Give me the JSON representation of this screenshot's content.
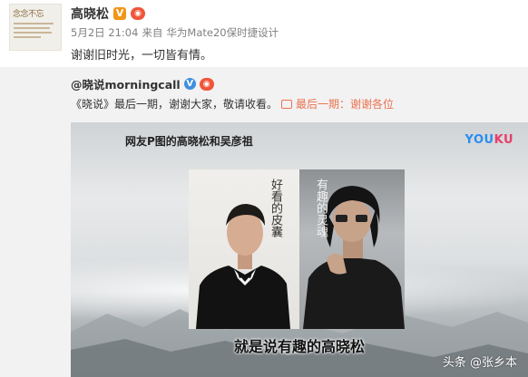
{
  "post": {
    "author_name": "高晓松",
    "verified_badge": "V",
    "date": "5月2日 21:04",
    "source_prefix": "来自",
    "source": "华为Mate20保时捷设计",
    "text": "谢谢旧时光，一切皆有情。"
  },
  "repost": {
    "author": "@晓说morningcall",
    "text_prefix": "《晓说》最后一期，谢谢大家，敬请收看。",
    "link_text": "最后一期：谢谢各位",
    "video": {
      "title": "网友P图的高晓松和吴彦祖",
      "logo_you": "YOU",
      "logo_ku": "KU",
      "subtitle": "就是说有趣的高晓松",
      "watermark": "头条 @张乡本"
    }
  },
  "colors": {
    "link_orange": "#eb7350",
    "verified_orange": "#f29618",
    "verified_blue": "#3f8fde",
    "repost_bg": "#f2f2f2"
  },
  "icons": [
    "avatar-image",
    "verified-icon",
    "medal-icon",
    "link-icon"
  ]
}
